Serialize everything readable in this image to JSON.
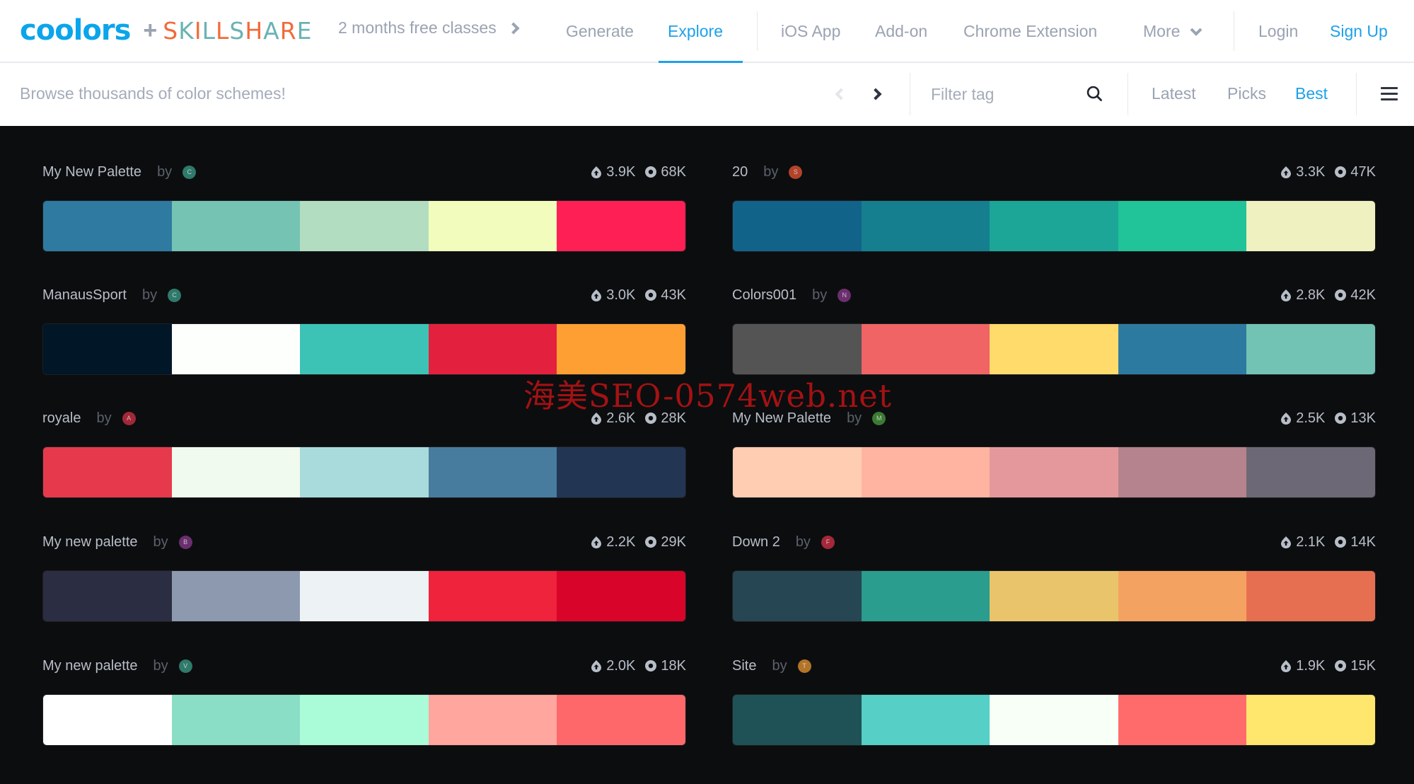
{
  "brand": {
    "logo_text": "coolors",
    "plus": "+",
    "partner_letters": [
      "S",
      "K",
      "I",
      "L",
      "L",
      "S",
      "H",
      "A",
      "R",
      "E"
    ],
    "partner_colors": [
      "#f26b3a",
      "#6bb3b4"
    ],
    "accent": "#1da1e8"
  },
  "promo": {
    "label": "2 months free classes",
    "icon": "chevron-right-icon"
  },
  "nav": {
    "primary": [
      {
        "label": "Generate",
        "active": false
      },
      {
        "label": "Explore",
        "active": true
      }
    ],
    "secondary": [
      {
        "label": "iOS App"
      },
      {
        "label": "Add-on"
      },
      {
        "label": "Chrome Extension"
      },
      {
        "label": "More",
        "icon": "chevron-down-icon"
      }
    ],
    "auth": {
      "login": "Login",
      "signup": "Sign Up"
    }
  },
  "subbar": {
    "browse_text": "Browse thousands of color schemes!",
    "filter_placeholder": "Filter tag",
    "filter_value": "",
    "sort_options": [
      {
        "label": "Latest",
        "active": false
      },
      {
        "label": "Picks",
        "active": false
      },
      {
        "label": "Best",
        "active": true
      }
    ]
  },
  "palettes": [
    {
      "name": "My New Palette",
      "by": "by",
      "avatar": "C",
      "avatar_color": "#2f7a6a",
      "saves": "3.9K",
      "views": "68K",
      "colors": [
        "#2e7aa0",
        "#75c3b3",
        "#b3ddc1",
        "#f2fcbd",
        "#fe1f55"
      ]
    },
    {
      "name": "20",
      "by": "by",
      "avatar": "S",
      "avatar_color": "#b2432b",
      "saves": "3.3K",
      "views": "47K",
      "colors": [
        "#12638a",
        "#157f90",
        "#1ba697",
        "#21c399",
        "#f0f1c0"
      ]
    },
    {
      "name": "ManausSport",
      "by": "by",
      "avatar": "C",
      "avatar_color": "#2f7a6a",
      "saves": "3.0K",
      "views": "43K",
      "colors": [
        "#011627",
        "#fdfffc",
        "#3cc3b6",
        "#e3213e",
        "#fe9f33"
      ]
    },
    {
      "name": "Colors001",
      "by": "by",
      "avatar": "N",
      "avatar_color": "#6b2f6e",
      "saves": "2.8K",
      "views": "42K",
      "colors": [
        "#545454",
        "#f06465",
        "#ffdb6c",
        "#2d7aa1",
        "#72c3b3"
      ]
    },
    {
      "name": "royale",
      "by": "by",
      "avatar": "A",
      "avatar_color": "#a02838",
      "saves": "2.6K",
      "views": "28K",
      "colors": [
        "#e63a4c",
        "#f1faee",
        "#a9dbdd",
        "#487c9e",
        "#223654"
      ]
    },
    {
      "name": "My New Palette",
      "by": "by",
      "avatar": "M",
      "avatar_color": "#3c7a34",
      "saves": "2.5K",
      "views": "13K",
      "colors": [
        "#ffcdb2",
        "#ffb4a2",
        "#e5989b",
        "#b5838d",
        "#6d6875"
      ]
    },
    {
      "name": "My new palette",
      "by": "by",
      "avatar": "B",
      "avatar_color": "#6a2f6e",
      "saves": "2.2K",
      "views": "29K",
      "colors": [
        "#2b2d42",
        "#8d99ae",
        "#edf2f4",
        "#ef233c",
        "#d90429"
      ]
    },
    {
      "name": "Down 2",
      "by": "by",
      "avatar": "F",
      "avatar_color": "#a4283a",
      "saves": "2.1K",
      "views": "14K",
      "colors": [
        "#264653",
        "#2a9d8f",
        "#e9c46a",
        "#f4a261",
        "#e76f51"
      ]
    },
    {
      "name": "My new palette",
      "by": "by",
      "avatar": "V",
      "avatar_color": "#2f7a6a",
      "saves": "2.0K",
      "views": "18K",
      "colors": [
        "#ffffff",
        "#8bdec6",
        "#aafbd8",
        "#ffa69e",
        "#ff686b"
      ]
    },
    {
      "name": "Site",
      "by": "by",
      "avatar": "T",
      "avatar_color": "#b27428",
      "saves": "1.9K",
      "views": "15K",
      "colors": [
        "#1f5256",
        "#56cfc6",
        "#f7fff7",
        "#ff6b6b",
        "#ffe66d"
      ]
    }
  ],
  "watermark": "海美SEO-0574web.net"
}
